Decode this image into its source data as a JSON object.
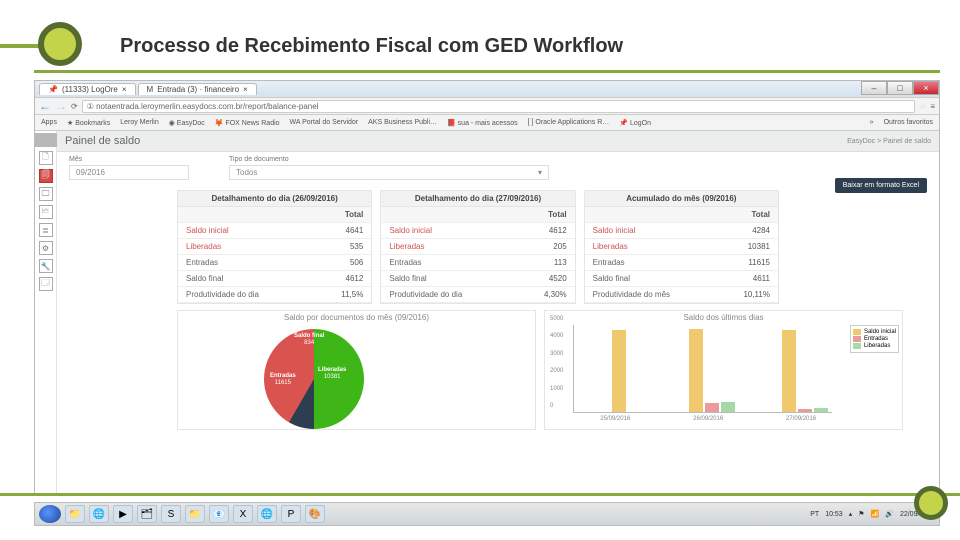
{
  "slide": {
    "title": "Processo de Recebimento Fiscal com GED Workflow"
  },
  "browser": {
    "tabs": [
      {
        "icon": "📌",
        "label": "(11333) LogOre"
      },
      {
        "icon": "M",
        "label": "Entrada (3) · financeiro"
      }
    ],
    "url": "① notaentrada.leroymerlin.easydocs.com.br/report/balance-panel",
    "bookmarks": [
      "Apps",
      "★ Bookmarks",
      "Leroy Merlin",
      "◉ EasyDoc",
      "🦊 FOX News Radio",
      "WA Portal do Servidor",
      "AKS Business Publi…",
      "📕 sua - mais acessos",
      "[ ] Oracle Applications R…",
      "📌 LogOn",
      "»",
      "Outros favoritos"
    ]
  },
  "rail": {
    "icons": [
      "🗋",
      "🗐",
      "🖵",
      "🗠",
      "≣",
      "⚙",
      "🔧",
      "🗔"
    ]
  },
  "page": {
    "title": "Painel de saldo",
    "crumb": "EasyDoc > Painel de saldo",
    "filter_month_label": "Mês",
    "filter_month_value": "09/2016",
    "filter_type_label": "Tipo de documento",
    "filter_type_value": "Todos",
    "excel": "Baixar em formato Excel"
  },
  "panels": [
    {
      "title": "Detalhamento do dia (26/09/2016)",
      "rows": [
        [
          "Saldo inicial",
          "4641"
        ],
        [
          "Liberadas",
          "535"
        ],
        [
          "Entradas",
          "506"
        ],
        [
          "Saldo final",
          "4612"
        ],
        [
          "Produtividade do dia",
          "11,5%"
        ]
      ]
    },
    {
      "title": "Detalhamento do dia (27/09/2016)",
      "rows": [
        [
          "Saldo inicial",
          "4612"
        ],
        [
          "Liberadas",
          "205"
        ],
        [
          "Entradas",
          "113"
        ],
        [
          "Saldo final",
          "4520"
        ],
        [
          "Produtividade do dia",
          "4,30%"
        ]
      ]
    },
    {
      "title": "Acumulado do mês (09/2016)",
      "rows": [
        [
          "Saldo inicial",
          "4284"
        ],
        [
          "Liberadas",
          "10381"
        ],
        [
          "Entradas",
          "11615"
        ],
        [
          "Saldo final",
          "4611"
        ],
        [
          "Produtividade do mês",
          "10,11%"
        ]
      ]
    }
  ],
  "pie": {
    "title": "Saldo por documentos do mês (09/2016)",
    "slices": [
      {
        "name": "Liberadas",
        "value": "10381",
        "color": "#3fb618"
      },
      {
        "name": "Saldo final",
        "value": "834",
        "color": "#2c3e50"
      },
      {
        "name": "Entradas",
        "value": "11615",
        "color": "#d9534f"
      }
    ]
  },
  "bar": {
    "title": "Saldo dos últimos dias",
    "yticks": [
      "0",
      "1000",
      "2000",
      "3000",
      "4000",
      "5000"
    ],
    "legend": [
      "Saldo inicial",
      "Entradas",
      "Liberadas"
    ],
    "categories": [
      "25/09/2016",
      "26/09/2016",
      "27/09/2016"
    ]
  },
  "taskbar": {
    "apps": [
      "📁",
      "🌐",
      "▶",
      "🗂",
      "S",
      "📁",
      "📧",
      "X",
      "🌐",
      "P",
      "🎨"
    ],
    "lang": "PT",
    "time": "10:53",
    "date": "22/09/2016"
  },
  "chart_data": [
    {
      "type": "pie",
      "title": "Saldo por documentos do mês (09/2016)",
      "series": [
        {
          "name": "slices",
          "values": [
            {
              "label": "Liberadas",
              "value": 10381
            },
            {
              "label": "Saldo final",
              "value": 834
            },
            {
              "label": "Entradas",
              "value": 11615
            }
          ]
        }
      ]
    },
    {
      "type": "bar",
      "title": "Saldo dos últimos dias",
      "categories": [
        "25/09/2016",
        "26/09/2016",
        "27/09/2016"
      ],
      "series": [
        {
          "name": "Saldo inicial",
          "values": [
            4600,
            4641,
            4612
          ]
        },
        {
          "name": "Entradas",
          "values": [
            0,
            506,
            113
          ]
        },
        {
          "name": "Liberadas",
          "values": [
            0,
            535,
            205
          ]
        }
      ],
      "ylabel": "",
      "xlabel": "",
      "ylim": [
        0,
        5000
      ]
    }
  ]
}
